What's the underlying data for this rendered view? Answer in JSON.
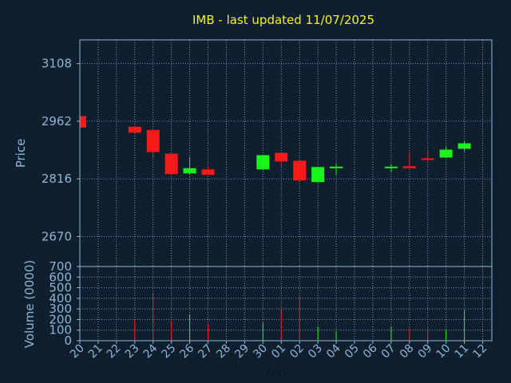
{
  "chart_data": {
    "type": "candlestick",
    "title": "IMB - last updated 11/07/2025",
    "xlabel": "Day",
    "ylabel": "Price",
    "volume_label": "Volume (0000)",
    "grid": true,
    "colors": {
      "background": "#0f1f2e",
      "axis": "#8fb5d6",
      "grid": "#8fb5d6",
      "title": "#f5f519",
      "up": "#19f519",
      "down": "#f51919"
    },
    "price_ticks": [
      2670,
      2816,
      2962,
      3108
    ],
    "price_range": [
      2594,
      3168
    ],
    "volume_ticks": [
      0,
      100,
      200,
      300,
      400,
      500,
      600,
      700
    ],
    "volume_range": [
      0,
      700
    ],
    "x_ticks": [
      "20",
      "21",
      "22",
      "23",
      "24",
      "25",
      "26",
      "27",
      "28",
      "29",
      "30",
      "01",
      "02",
      "03",
      "04",
      "05",
      "06",
      "07",
      "08",
      "09",
      "10",
      "11",
      "12"
    ],
    "candles": [
      {
        "day": "20",
        "open": 2975,
        "high": 2975,
        "low": 2946,
        "close": 2946,
        "volume": 0
      },
      {
        "day": "23",
        "open": 2948,
        "high": 2950,
        "low": 2932,
        "close": 2933,
        "volume": 200
      },
      {
        "day": "24",
        "open": 2940,
        "high": 2940,
        "low": 2870,
        "close": 2884,
        "volume": 450
      },
      {
        "day": "25",
        "open": 2880,
        "high": 2880,
        "low": 2828,
        "close": 2828,
        "volume": 190
      },
      {
        "day": "26",
        "open": 2830,
        "high": 2870,
        "low": 2826,
        "close": 2843,
        "volume": 250
      },
      {
        "day": "27",
        "open": 2840,
        "high": 2848,
        "low": 2826,
        "close": 2826,
        "volume": 160
      },
      {
        "day": "30",
        "open": 2840,
        "high": 2875,
        "low": 2838,
        "close": 2876,
        "volume": 170
      },
      {
        "day": "01",
        "open": 2882,
        "high": 2882,
        "low": 2848,
        "close": 2860,
        "volume": 290
      },
      {
        "day": "02",
        "open": 2862,
        "high": 2866,
        "low": 2810,
        "close": 2812,
        "volume": 420
      },
      {
        "day": "03",
        "open": 2808,
        "high": 2846,
        "low": 2806,
        "close": 2846,
        "volume": 130
      },
      {
        "day": "04",
        "open": 2846,
        "high": 2855,
        "low": 2825,
        "close": 2847,
        "volume": 90
      },
      {
        "day": "07",
        "open": 2845,
        "high": 2852,
        "low": 2832,
        "close": 2847,
        "volume": 130
      },
      {
        "day": "08",
        "open": 2848,
        "high": 2883,
        "low": 2842,
        "close": 2843,
        "volume": 120
      },
      {
        "day": "09",
        "open": 2868,
        "high": 2888,
        "low": 2860,
        "close": 2864,
        "volume": 100
      },
      {
        "day": "10",
        "open": 2870,
        "high": 2897,
        "low": 2868,
        "close": 2890,
        "volume": 100
      },
      {
        "day": "11",
        "open": 2892,
        "high": 2910,
        "low": 2885,
        "close": 2906,
        "volume": 290
      }
    ]
  }
}
